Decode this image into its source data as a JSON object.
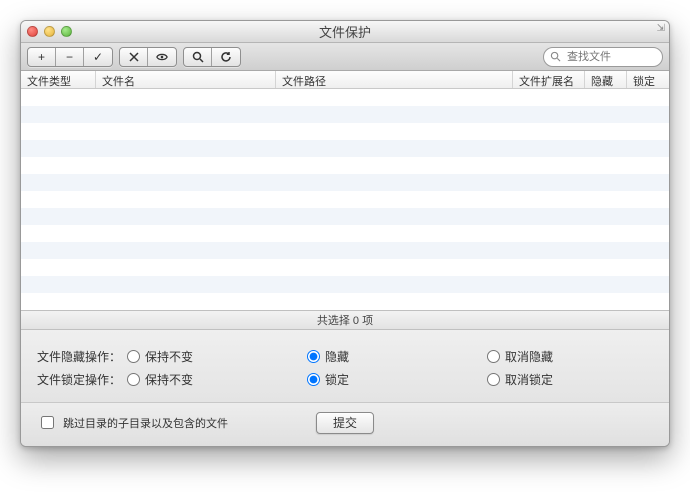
{
  "window": {
    "title": "文件保护"
  },
  "toolbar": {
    "add": "+",
    "remove": "−",
    "check": "✓",
    "search_placeholder": "查找文件"
  },
  "columns": {
    "type": "文件类型",
    "name": "文件名",
    "path": "文件路径",
    "ext": "文件扩展名",
    "hidden": "隐藏",
    "locked": "锁定"
  },
  "status": "共选择 0 项",
  "hide": {
    "label": "文件隐藏操作：",
    "keep": "保持不变",
    "do": "隐藏",
    "undo": "取消隐藏"
  },
  "lock": {
    "label": "文件锁定操作：",
    "keep": "保持不变",
    "do": "锁定",
    "undo": "取消锁定"
  },
  "skip_subdirs": "跳过目录的子目录以及包含的文件",
  "submit": "提交"
}
